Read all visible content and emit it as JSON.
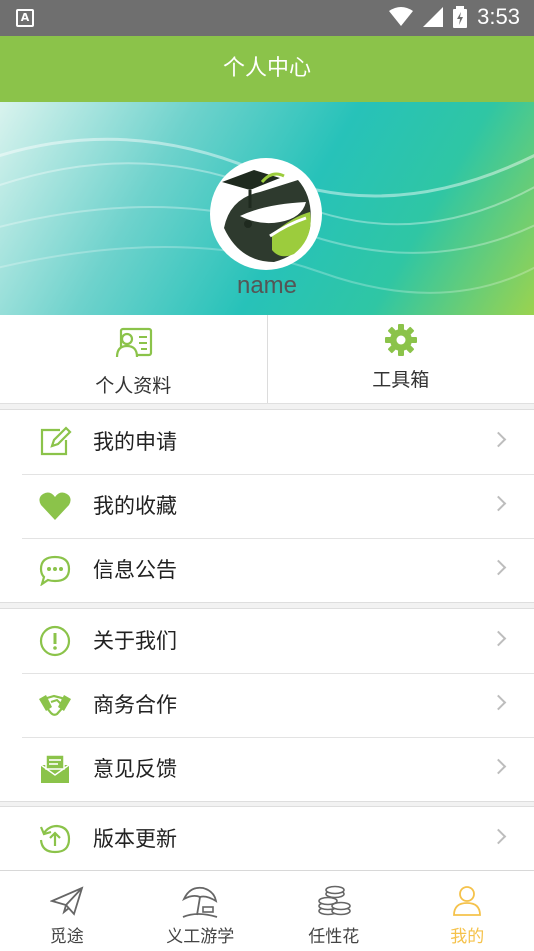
{
  "status_bar": {
    "time": "3:53",
    "notification_glyph": "A"
  },
  "header": {
    "title": "个人中心"
  },
  "profile": {
    "username": "name"
  },
  "quick_actions": [
    {
      "label": "个人资料",
      "icon": "profile-card-icon"
    },
    {
      "label": "工具箱",
      "icon": "gear-icon"
    }
  ],
  "menu_groups": [
    {
      "items": [
        {
          "label": "我的申请",
          "icon": "edit-icon"
        },
        {
          "label": "我的收藏",
          "icon": "heart-icon"
        },
        {
          "label": "信息公告",
          "icon": "chat-bubble-icon"
        }
      ]
    },
    {
      "items": [
        {
          "label": "关于我们",
          "icon": "info-icon"
        },
        {
          "label": "商务合作",
          "icon": "handshake-icon"
        },
        {
          "label": "意见反馈",
          "icon": "feedback-mail-icon"
        }
      ]
    },
    {
      "items": [
        {
          "label": "版本更新",
          "icon": "update-icon"
        }
      ]
    }
  ],
  "bottom_nav": [
    {
      "label": "觅途",
      "icon": "paper-plane-icon"
    },
    {
      "label": "义工游学",
      "icon": "beach-umbrella-icon"
    },
    {
      "label": "任性花",
      "icon": "coins-icon"
    },
    {
      "label": "我的",
      "icon": "user-icon",
      "active": true
    }
  ],
  "colors": {
    "brand_green": "#8bc34a",
    "active_tab": "#f5c24b",
    "status_bar": "#6f6f6f"
  }
}
